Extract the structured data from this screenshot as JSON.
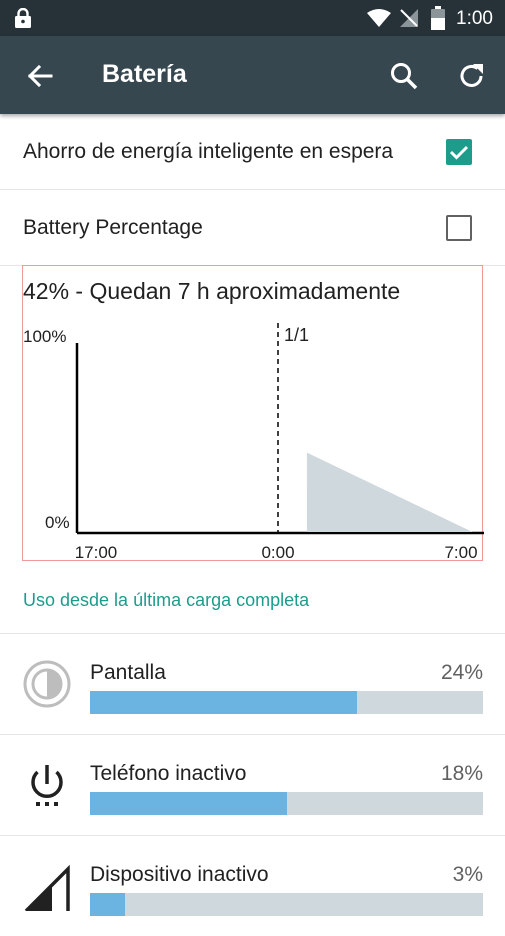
{
  "status_bar": {
    "time": "1:00"
  },
  "app_bar": {
    "title": "Batería"
  },
  "settings": [
    {
      "label": "Ahorro de energía inteligente en espera",
      "checked": true
    },
    {
      "label": "Battery Percentage",
      "checked": false
    }
  ],
  "chart_data": {
    "type": "area",
    "title": "42% - Quedan 7 h aproximadamente",
    "y_tick_labels": [
      "100%",
      "0%"
    ],
    "x_tick_labels": [
      "17:00",
      "0:00",
      "7:00"
    ],
    "marker_label": "1/1",
    "ylim": [
      0,
      100
    ],
    "series": [
      {
        "kind": "estimate",
        "color": "#cfd8dc",
        "points": [
          {
            "x": "1:00",
            "y": 42
          },
          {
            "x": "7:00",
            "y": 0
          }
        ]
      }
    ]
  },
  "usage_header": "Uso desde la última carga completa",
  "usage_items": [
    {
      "name": "Pantalla",
      "percent_label": "24%",
      "fraction": 0.68
    },
    {
      "name": "Teléfono inactivo",
      "percent_label": "18%",
      "fraction": 0.5
    },
    {
      "name": "Dispositivo inactivo",
      "percent_label": "3%",
      "fraction": 0.09
    }
  ]
}
